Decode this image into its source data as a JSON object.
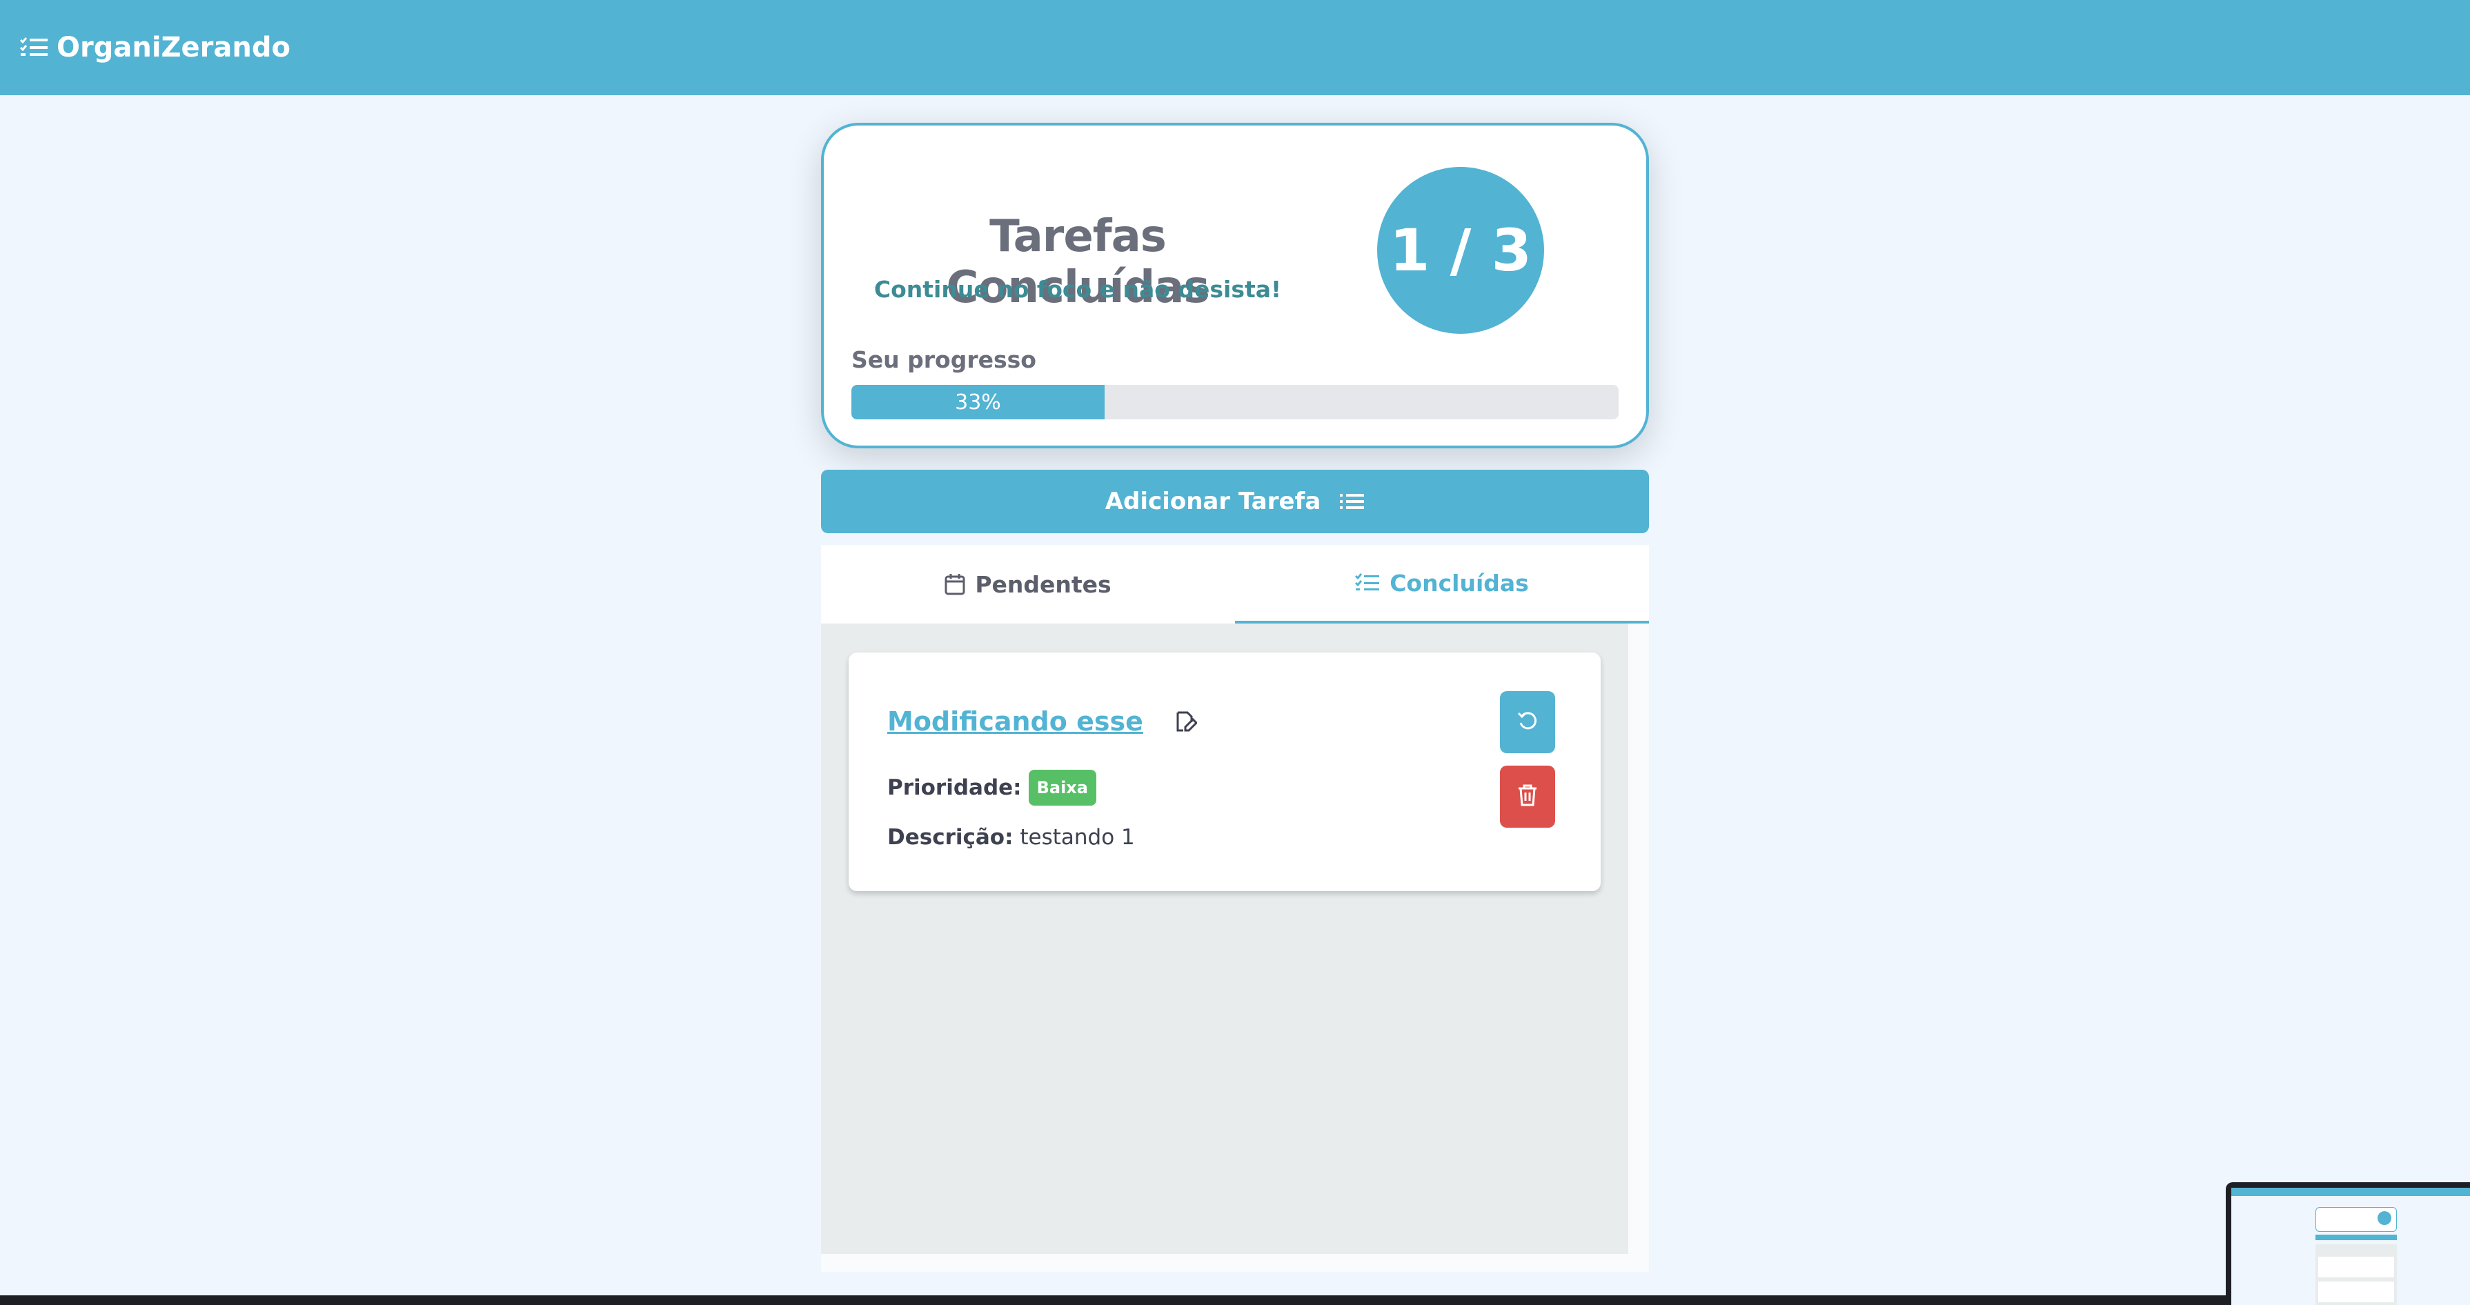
{
  "app": {
    "brand": "OrganiZerando"
  },
  "summary": {
    "title": "Tarefas Concluídas",
    "subtitle": "Continue no foco e não desista!",
    "completed_counter": "1 / 3",
    "progress_label": "Seu progresso",
    "progress_percent_text": "33%",
    "progress_fraction": 0.33
  },
  "actions": {
    "add_task_label": "Adicionar Tarefa"
  },
  "tabs": [
    {
      "label": "Pendentes",
      "icon": "calendar-icon",
      "active": false
    },
    {
      "label": "Concluídas",
      "icon": "checklist-icon",
      "active": true
    }
  ],
  "tasks": [
    {
      "title": "Modificando esse",
      "priority_label": "Prioridade:",
      "priority": "Baixa",
      "description_label": "Descrição:",
      "description": "testando 1"
    }
  ],
  "colors": {
    "primary": "#52b3d3",
    "danger": "#dc4f4b",
    "success": "#57c066",
    "background": "#eff6fd"
  }
}
